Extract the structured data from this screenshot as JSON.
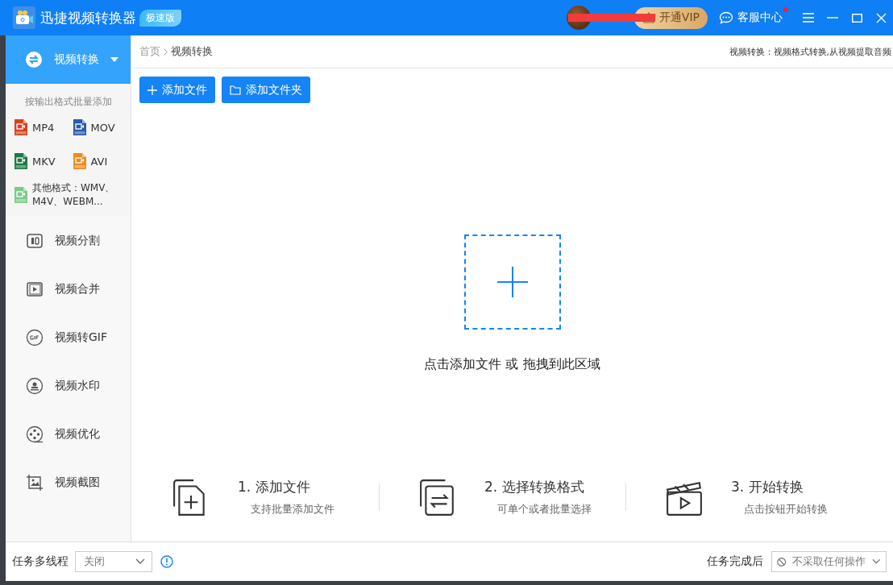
{
  "window": {
    "title": "迅捷视频转换器",
    "edition_badge": "极速版"
  },
  "header": {
    "vip_button": "开通VIP",
    "service": "客服中心",
    "service_unread": true
  },
  "sidebar": {
    "nav": [
      {
        "label": "视频转换",
        "selected": true
      }
    ],
    "format_hint": "按输出格式批量添加",
    "formats": [
      {
        "label": "MP4",
        "color": "#d6421c"
      },
      {
        "label": "MOV",
        "color": "#2c5aa6"
      },
      {
        "label": "MKV",
        "color": "#1f7a45"
      },
      {
        "label": "AVI",
        "color": "#f08a1e"
      }
    ],
    "other_formats": {
      "label": "其他格式：WMV、M4V、WEBM...",
      "color": "#7cc98a"
    },
    "tools": [
      {
        "label": "视频分割",
        "kind": "split",
        "selected": false
      },
      {
        "label": "视频合并",
        "kind": "merge",
        "selected": false
      },
      {
        "label": "视频转GIF",
        "kind": "gif",
        "selected": false
      },
      {
        "label": "视频水印",
        "kind": "watermark",
        "selected": false
      },
      {
        "label": "视频优化",
        "kind": "optimize",
        "selected": false
      },
      {
        "label": "视频截图",
        "kind": "screenshot",
        "selected": false
      }
    ]
  },
  "breadcrumb": [
    "首页",
    "视频转换"
  ],
  "description": "视频转换：视频格式转换,从视频提取音频",
  "toolbar": [
    {
      "label": "添加文件",
      "kind": "file"
    },
    {
      "label": "添加文件夹",
      "kind": "folder"
    }
  ],
  "drop_zone": {
    "label": "点击添加文件 或 拖拽到此区域"
  },
  "steps": [
    {
      "title": "1. 添加文件",
      "subtitle": "支持批量添加文件",
      "kind": "add"
    },
    {
      "title": "2. 选择转换格式",
      "subtitle": "可单个或者批量选择",
      "kind": "format"
    },
    {
      "title": "3. 开始转换",
      "subtitle": "点击按钮开始转换",
      "kind": "start"
    }
  ],
  "status_bar": {
    "threads_label": "任务多线程",
    "threads_value": "关闭",
    "after_label": "任务完成后",
    "after_value": "不采取任何操作"
  }
}
